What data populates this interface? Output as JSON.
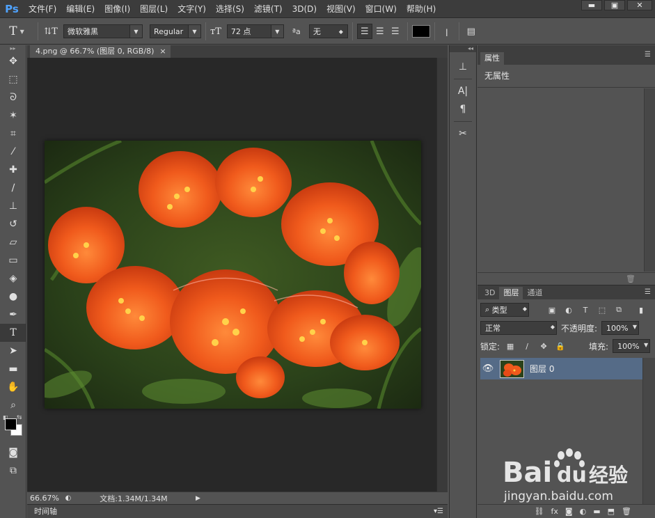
{
  "app": {
    "logo": "Ps"
  },
  "menu": [
    "文件(F)",
    "编辑(E)",
    "图像(I)",
    "图层(L)",
    "文字(Y)",
    "选择(S)",
    "滤镜(T)",
    "3D(D)",
    "视图(V)",
    "窗口(W)",
    "帮助(H)"
  ],
  "window_controls": {
    "minimize": "▬",
    "maximize": "▣",
    "close": "✕"
  },
  "options": {
    "tool_glyph": "T",
    "font_family": "微软雅黑",
    "font_style": "Regular",
    "font_size": "72 点",
    "aa_label": "ªa",
    "antialias": "无",
    "text_color": "#000000"
  },
  "tools": [
    {
      "name": "move-tool-icon",
      "glyph": "✥"
    },
    {
      "name": "marquee-tool-icon",
      "glyph": "⬚"
    },
    {
      "name": "lasso-tool-icon",
      "glyph": "ᘐ"
    },
    {
      "name": "magic-wand-tool-icon",
      "glyph": "✶"
    },
    {
      "name": "crop-tool-icon",
      "glyph": "⌗"
    },
    {
      "name": "eyedropper-tool-icon",
      "glyph": "⁄"
    },
    {
      "name": "healing-brush-tool-icon",
      "glyph": "✚"
    },
    {
      "name": "brush-tool-icon",
      "glyph": "∕"
    },
    {
      "name": "stamp-tool-icon",
      "glyph": "⊥"
    },
    {
      "name": "history-brush-tool-icon",
      "glyph": "↺"
    },
    {
      "name": "eraser-tool-icon",
      "glyph": "▱"
    },
    {
      "name": "gradient-tool-icon",
      "glyph": "▭"
    },
    {
      "name": "blur-tool-icon",
      "glyph": "◈"
    },
    {
      "name": "dodge-tool-icon",
      "glyph": "●"
    },
    {
      "name": "pen-tool-icon",
      "glyph": "✒"
    },
    {
      "name": "type-tool-icon",
      "glyph": "T"
    },
    {
      "name": "path-selection-tool-icon",
      "glyph": "➤"
    },
    {
      "name": "shape-tool-icon",
      "glyph": "▬"
    },
    {
      "name": "hand-tool-icon",
      "glyph": "✋"
    },
    {
      "name": "zoom-tool-icon",
      "glyph": "⌕"
    }
  ],
  "document": {
    "tab_title": "4.png @ 66.7% (图层 0, RGB/8)",
    "tab_close": "×",
    "zoom": "66.67%",
    "doc_info": "文档:1.34M/1.34M"
  },
  "timeline": {
    "label": "时间轴"
  },
  "properties": {
    "tab": "属性",
    "empty_text": "无属性"
  },
  "layers": {
    "tabs": [
      "3D",
      "图层",
      "通道"
    ],
    "filter_kind": "类型",
    "blend_mode": "正常",
    "opacity_label": "不透明度:",
    "opacity": "100%",
    "lock_label": "锁定:",
    "fill_label": "填充:",
    "fill": "100%",
    "layer_name": "图层 0",
    "footer_icons": [
      "⛓",
      "fx",
      "◙",
      "◐",
      "▬",
      "⬒",
      "🗑"
    ]
  },
  "watermark": {
    "text1": "Bai",
    "text2": "du",
    "text3": "经验",
    "url": "jingyan.baidu.com"
  }
}
